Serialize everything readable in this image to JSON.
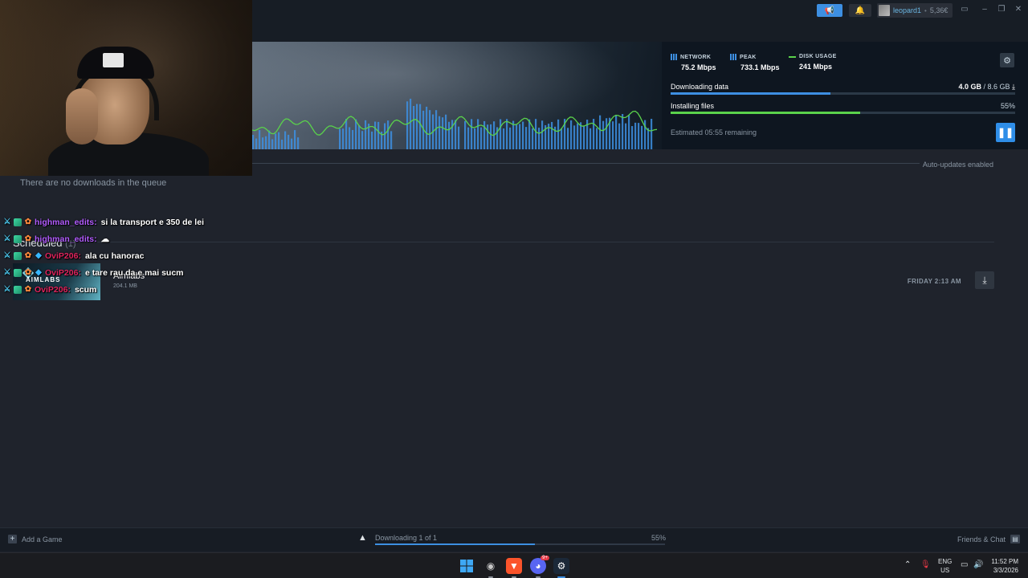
{
  "titlebar": {
    "username": "leopard1",
    "balance": "5,36€",
    "icons": [
      "megaphone-icon",
      "bell-icon",
      "monitor-icon",
      "minimize-icon",
      "maximize-icon",
      "close-icon"
    ]
  },
  "download_header": {
    "stats": [
      {
        "label": "NETWORK",
        "value": "75.2 Mbps"
      },
      {
        "label": "PEAK",
        "value": "733.1 Mbps"
      },
      {
        "label": "DISK USAGE",
        "value": "241 Mbps"
      }
    ],
    "downloading": {
      "label": "Downloading data",
      "current": "4.0 GB",
      "total": "8.6 GB",
      "fraction": 0.465
    },
    "installing": {
      "label": "Installing files",
      "percent_text": "55%",
      "fraction": 0.55
    },
    "eta": "Estimated 05:55 remaining",
    "colors": {
      "network_bars": "#3d8fe2",
      "disk_line": "#5ad24b",
      "accent": "#2f8ee8"
    }
  },
  "queue": {
    "auto_updates": "Auto-updates enabled",
    "empty_text": "There are no downloads in the queue"
  },
  "scheduled": {
    "title": "Scheduled",
    "count": "(1)",
    "items": [
      {
        "name": "Aimlabs",
        "brand": "AIMLABS",
        "size": "204.1 MB",
        "date": "FRIDAY 2:13 AM"
      }
    ]
  },
  "chat": [
    {
      "user": "highman_edits:",
      "message": "si la transport e 350 de lei",
      "color": "#b25cff"
    },
    {
      "user": "highman_edits:",
      "message": "☁",
      "color": "#b25cff"
    },
    {
      "user": "OviP206:",
      "message": "ala cu hanorac",
      "color": "#e0245e"
    },
    {
      "user": "OviP206:",
      "message": "e tare rau da e mai sucm",
      "color": "#e0245e"
    },
    {
      "user": "OviP206:",
      "message": "scum",
      "color": "#e0245e"
    }
  ],
  "bottom_bar": {
    "add_game": "Add a Game",
    "status": "Downloading 1 of 1",
    "percent": "55%",
    "fraction": 0.55,
    "friends_chat": "Friends & Chat"
  },
  "taskbar": {
    "language": "ENG",
    "region": "US",
    "time": "11:52 PM",
    "date": "3/3/2026",
    "discord_badge": "9+"
  }
}
